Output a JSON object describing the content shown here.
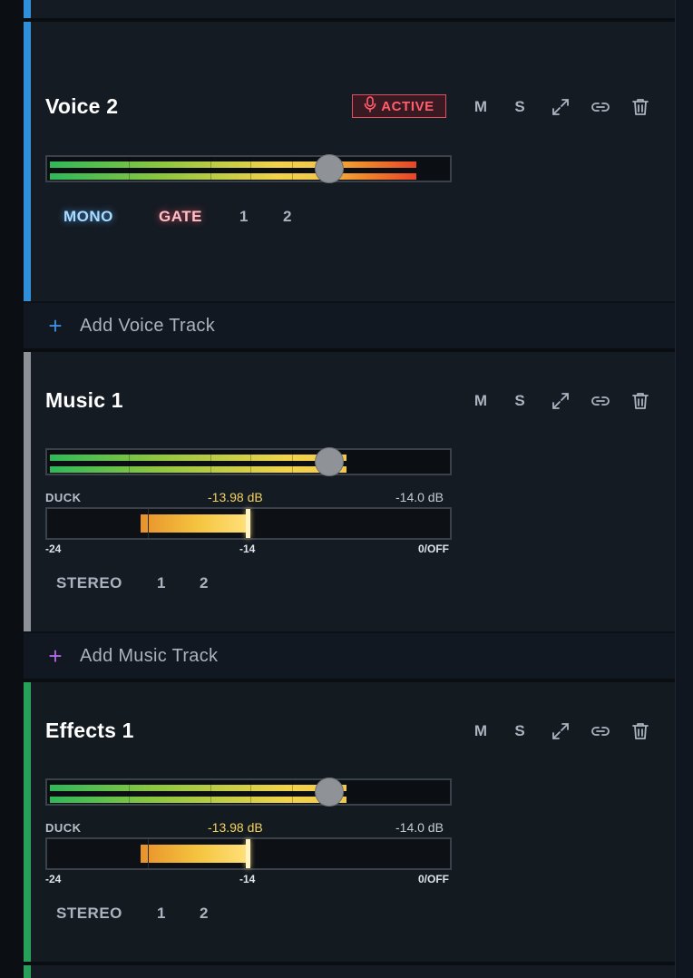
{
  "tracks": [
    {
      "name": "Voice 2",
      "accent_color": "#2f8fd8",
      "active_label": "ACTIVE",
      "controls": {
        "mute": "M",
        "solo": "S"
      },
      "volume_level": 0.7,
      "chips": {
        "mode": "MONO",
        "gate": "GATE",
        "ch1": "1",
        "ch2": "2"
      }
    },
    {
      "name": "Music 1",
      "accent_color": "#8e9298",
      "controls": {
        "mute": "M",
        "solo": "S"
      },
      "volume_level": 0.7,
      "duck": {
        "label": "DUCK",
        "value": "-13.98 dB",
        "threshold": "-14.0 dB",
        "ticks": [
          "-24",
          "-14",
          "0/OFF"
        ]
      },
      "chips": {
        "mode": "STEREO",
        "ch1": "1",
        "ch2": "2"
      }
    },
    {
      "name": "Effects 1",
      "accent_color": "#27a05a",
      "controls": {
        "mute": "M",
        "solo": "S"
      },
      "volume_level": 0.7,
      "duck": {
        "label": "DUCK",
        "value": "-13.98 dB",
        "threshold": "-14.0 dB",
        "ticks": [
          "-24",
          "-14",
          "0/OFF"
        ]
      },
      "chips": {
        "mode": "STEREO",
        "ch1": "1",
        "ch2": "2"
      }
    }
  ],
  "add_voice_track": "Add Voice Track",
  "add_music_track": "Add Music Track",
  "icons": {
    "active": "microphone-icon",
    "expand": "expand-icon",
    "link": "link-icon",
    "delete": "trash-icon",
    "add": "plus-icon"
  },
  "colors": {
    "voice_accent": "#2f8fd8",
    "music_accent": "#8e9298",
    "effects_accent": "#27a05a",
    "active_red": "#ff5f6d",
    "duck_yellow": "#f3d25e"
  }
}
